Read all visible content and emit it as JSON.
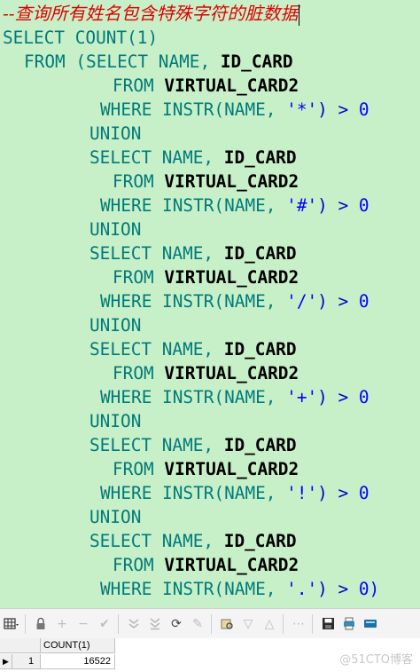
{
  "editor": {
    "comment": "--查询所有姓名包含特殊字符的脏数据",
    "lines": [
      {
        "kw": "SELECT",
        "rest": " COUNT(1)"
      },
      {
        "kw": "FROM",
        "rest": " (SELECT NAME, ",
        "ident": "ID_CARD"
      },
      {
        "kw": "FROM",
        "ident": "VIRTUAL_CARD2"
      },
      {
        "kw": "WHERE",
        "rest": " INSTR(NAME, ",
        "str": "'*'",
        "tail": ") > ",
        "num": "0"
      },
      {
        "kw": "UNION"
      },
      {
        "kw": "SELECT",
        "rest": " NAME, ",
        "ident": "ID_CARD"
      },
      {
        "kw": "FROM",
        "ident": "VIRTUAL_CARD2"
      },
      {
        "kw": "WHERE",
        "rest": " INSTR(NAME, ",
        "str": "'#'",
        "tail": ") > ",
        "num": "0"
      },
      {
        "kw": "UNION"
      },
      {
        "kw": "SELECT",
        "rest": " NAME, ",
        "ident": "ID_CARD"
      },
      {
        "kw": "FROM",
        "ident": "VIRTUAL_CARD2"
      },
      {
        "kw": "WHERE",
        "rest": " INSTR(NAME, ",
        "str": "'/'",
        "tail": ") > ",
        "num": "0"
      },
      {
        "kw": "UNION"
      },
      {
        "kw": "SELECT",
        "rest": " NAME, ",
        "ident": "ID_CARD"
      },
      {
        "kw": "FROM",
        "ident": "VIRTUAL_CARD2"
      },
      {
        "kw": "WHERE",
        "rest": " INSTR(NAME, ",
        "str": "'+'",
        "tail": ") > ",
        "num": "0"
      },
      {
        "kw": "UNION"
      },
      {
        "kw": "SELECT",
        "rest": " NAME, ",
        "ident": "ID_CARD"
      },
      {
        "kw": "FROM",
        "ident": "VIRTUAL_CARD2"
      },
      {
        "kw": "WHERE",
        "rest": " INSTR(NAME, ",
        "str": "'!'",
        "tail": ") > ",
        "num": "0"
      },
      {
        "kw": "UNION"
      },
      {
        "kw": "SELECT",
        "rest": " NAME, ",
        "ident": "ID_CARD"
      },
      {
        "kw": "FROM",
        "ident": "VIRTUAL_CARD2"
      },
      {
        "kw": "WHERE",
        "rest": " INSTR(NAME, ",
        "str": "'.'",
        "tail": ") > ",
        "num": "0)"
      }
    ]
  },
  "toolbar": {
    "icons": [
      "grid-menu-icon",
      "lock-icon",
      "add-row-icon",
      "delete-row-icon",
      "post-changes-icon",
      "fetch-next-icon",
      "fetch-last-icon",
      "refresh-icon",
      "clear-icon",
      "query-by-example-icon",
      "sort-down-icon",
      "sort-up-icon",
      "link-icon",
      "save-icon",
      "print-icon",
      "export-icon"
    ]
  },
  "results": {
    "column": "COUNT(1)",
    "row_number": "1",
    "value": "16522"
  },
  "watermark": "@51CTO博客"
}
